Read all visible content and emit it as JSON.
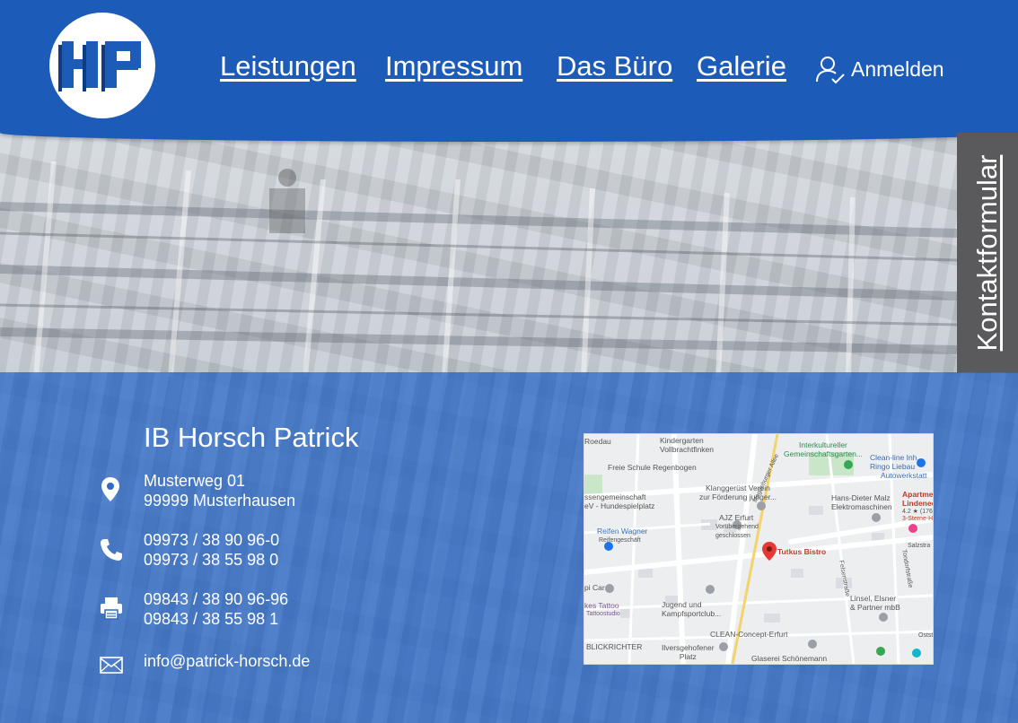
{
  "header": {
    "logo_text": "HP",
    "nav": [
      {
        "label": "Leistungen"
      },
      {
        "label": "Impressum"
      },
      {
        "label": "Das Büro"
      },
      {
        "label": "Galerie"
      }
    ],
    "login_label": "Anmelden"
  },
  "side_tab": {
    "label": "Kontaktformular"
  },
  "contact": {
    "company": "IB Horsch Patrick",
    "address_line1": "Musterweg 01",
    "address_line2": "99999 Musterhausen",
    "phone_line1": "09973 / 38 90 96-0",
    "phone_line2": "09973 / 38 55 98 0",
    "fax_line1": "09843 / 38 90 96-96",
    "fax_line2": "09843 / 38 55 98 1",
    "email": "info@patrick-horsch.de"
  },
  "map": {
    "labels": {
      "kindergarten": "Kindergarten\nVollbrachtfinken",
      "freie_schule": "Freie Schule Regenbogen",
      "interkultureller": "Interkultureller\nGemeinschaftsgarten...",
      "clean_line": "Clean-line Inh.\nRingo Liebau",
      "clean_line_sub": "Autowerkstatt",
      "klangger": "Klanggerüst Verein\nzur Förderung junger...",
      "hunde": "ssengemeinschaft\neV - Hundespielplatz",
      "malz": "Hans-Dieter Malz\nElektromaschinen",
      "apartment": "Apartme\nLindenec",
      "apartment_rating": "4.2 ★ (176)",
      "apartment_sub": "3-Sterne-Ho",
      "ajz": "AJZ Erfurt",
      "ajz_sub": "Vorübergehend\ngeschlossen",
      "reifen": "Reifen Wagner",
      "reifen_sub": "Reifengeschäft",
      "tutkus": "Tutkus Bistro",
      "pi_car": "pi Car",
      "kes_tattoo": "kes Tattoo",
      "tattoo_sub": "Tattoostudio",
      "jugend": "Jugend und\nKampfsportclub...",
      "linsel": "Linsel, Elsner\n& Partner mbB",
      "blickrichter": "BLICKRICHTER",
      "clean_concept": "CLEAN-Concept-Erfurt",
      "ilvers": "Ilversgehofener\nPlatz",
      "glaserei": "Glaserei Schönemann",
      "roedau": "Roedau",
      "magdeburger": "Magdeburger Allee",
      "salzstr": "Salzstra",
      "oststr": "Oststr",
      "felsenstr": "Felsenstraße",
      "tronde": "Tondorfstraße"
    }
  }
}
